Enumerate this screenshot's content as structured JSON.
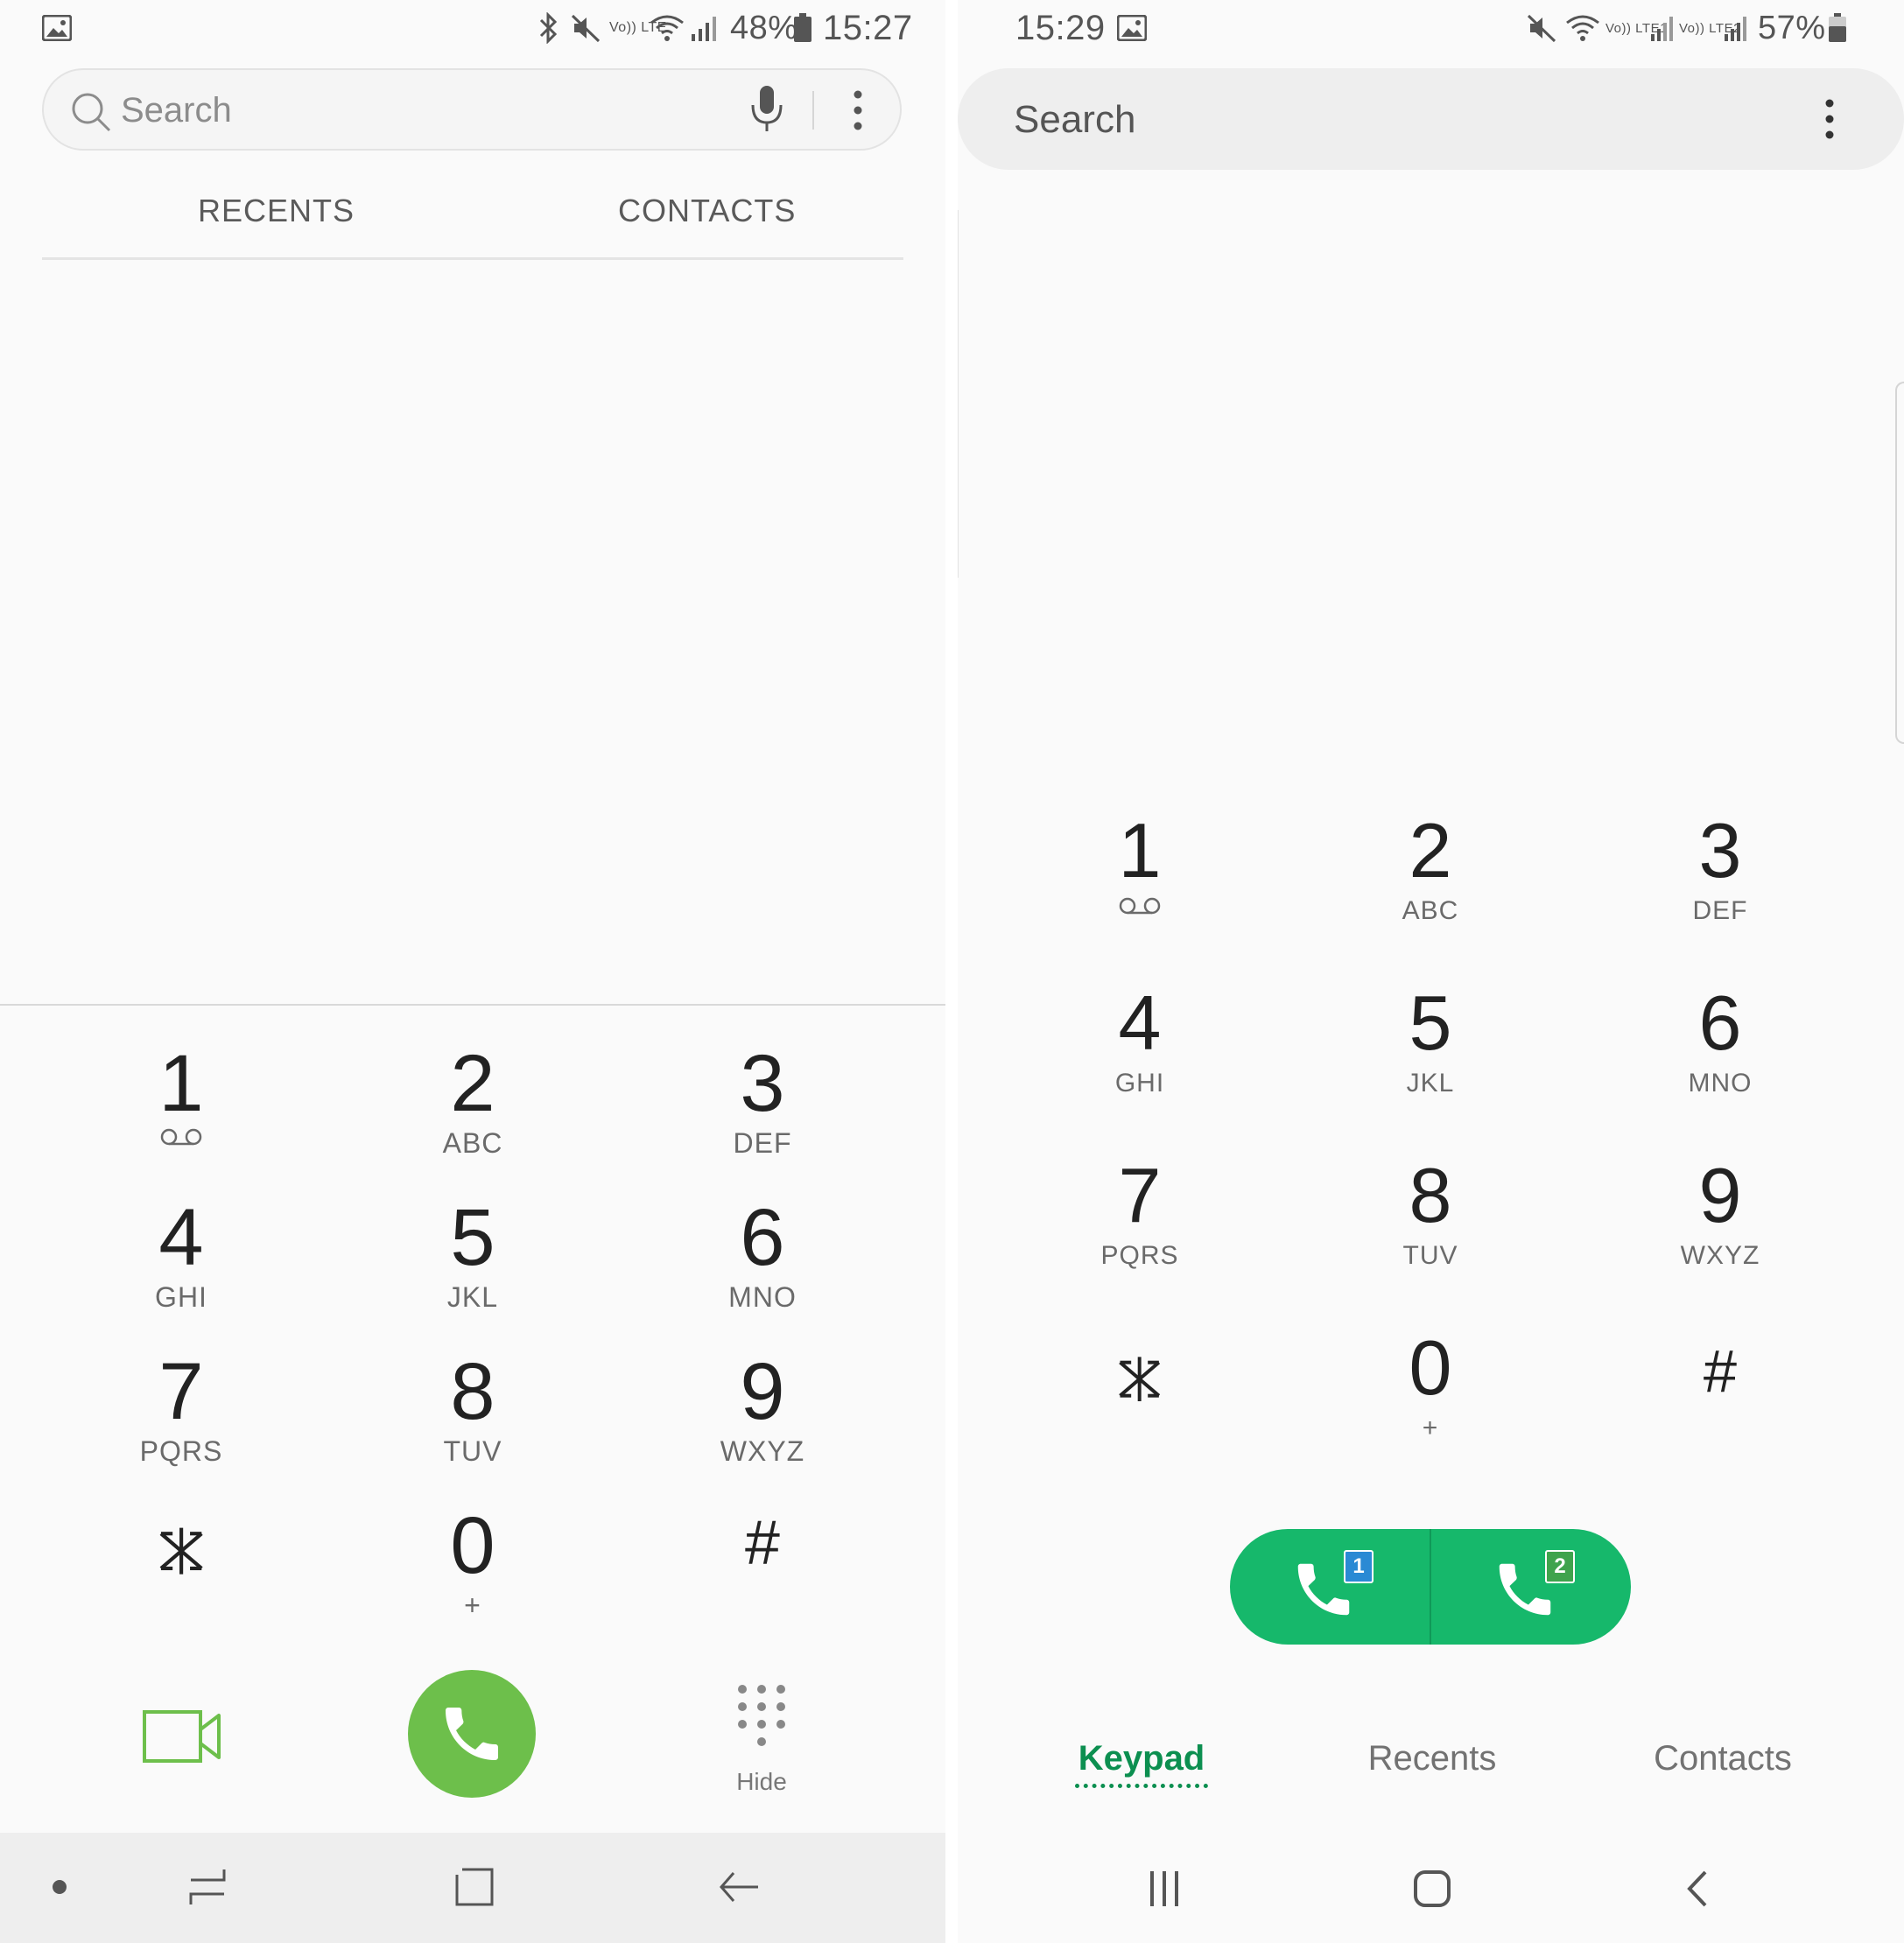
{
  "left": {
    "status": {
      "battery": "48%",
      "time": "15:27",
      "volte": "Vo)) LTE"
    },
    "search": {
      "placeholder": "Search"
    },
    "tabs": [
      {
        "label": "RECENTS"
      },
      {
        "label": "CONTACTS"
      }
    ],
    "keys": [
      {
        "digit": "1",
        "letters": ""
      },
      {
        "digit": "2",
        "letters": "ABC"
      },
      {
        "digit": "3",
        "letters": "DEF"
      },
      {
        "digit": "4",
        "letters": "GHI"
      },
      {
        "digit": "5",
        "letters": "JKL"
      },
      {
        "digit": "6",
        "letters": "MNO"
      },
      {
        "digit": "7",
        "letters": "PQRS"
      },
      {
        "digit": "8",
        "letters": "TUV"
      },
      {
        "digit": "9",
        "letters": "WXYZ"
      },
      {
        "digit": "*",
        "letters": ""
      },
      {
        "digit": "0",
        "letters": "+"
      },
      {
        "digit": "#",
        "letters": ""
      }
    ],
    "hide_label": "Hide",
    "colors": {
      "call_green": "#6dbf4b",
      "video_green": "#6dbf4b"
    }
  },
  "right": {
    "status": {
      "time": "15:29",
      "battery": "57%",
      "sim1": "Vo)) LTE1",
      "sim2": "Vo)) LTE2"
    },
    "search": {
      "placeholder": "Search"
    },
    "keys": [
      {
        "digit": "1",
        "letters": ""
      },
      {
        "digit": "2",
        "letters": "ABC"
      },
      {
        "digit": "3",
        "letters": "DEF"
      },
      {
        "digit": "4",
        "letters": "GHI"
      },
      {
        "digit": "5",
        "letters": "JKL"
      },
      {
        "digit": "6",
        "letters": "MNO"
      },
      {
        "digit": "7",
        "letters": "PQRS"
      },
      {
        "digit": "8",
        "letters": "TUV"
      },
      {
        "digit": "9",
        "letters": "WXYZ"
      },
      {
        "digit": "*",
        "letters": ""
      },
      {
        "digit": "0",
        "letters": "+"
      },
      {
        "digit": "#",
        "letters": ""
      }
    ],
    "call": {
      "sim1_badge": "1",
      "sim2_badge": "2"
    },
    "tabs": [
      {
        "label": "Keypad"
      },
      {
        "label": "Recents"
      },
      {
        "label": "Contacts"
      }
    ],
    "colors": {
      "call_green": "#16b86b",
      "active_tab": "#0c8f50",
      "sim1_badge": "#2a8ad4",
      "sim2_badge": "#3fa34d"
    }
  }
}
